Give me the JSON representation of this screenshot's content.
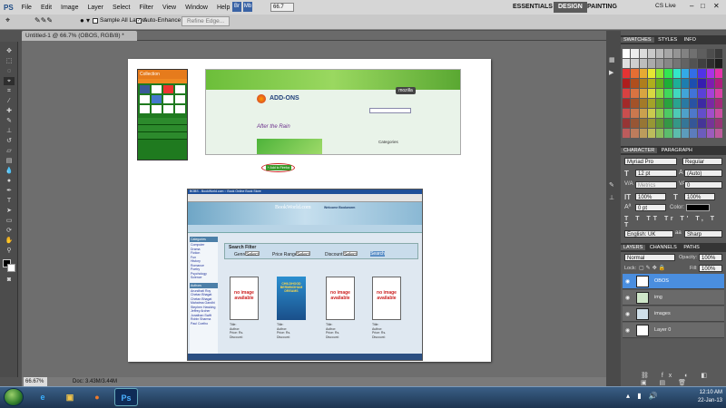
{
  "menubar": {
    "logo": "PS",
    "items": [
      "File",
      "Edit",
      "Image",
      "Layer",
      "Select",
      "Filter",
      "View",
      "Window",
      "Help"
    ],
    "zoom_box": "66.7",
    "workspaces": [
      "ESSENTIALS",
      "DESIGN",
      "PAINTING"
    ],
    "cs_live": "CS Live"
  },
  "options_bar": {
    "sample_all_layers": "Sample All Layers",
    "auto_enhance": "Auto-Enhance",
    "refine_edge": "Refine Edge..."
  },
  "document_tab": "Untitled-1 @ 66.7% (OBOS, RGB/8) *",
  "status": {
    "zoom": "66.67%",
    "doc": "Doc: 3.43M/3.44M"
  },
  "panels": {
    "swatches_tabs": [
      "SWATCHES",
      "STYLES",
      "INFO"
    ],
    "character_tabs": [
      "CHARACTER",
      "PARAGRAPH"
    ],
    "font_family": "Myriad Pro",
    "font_style": "Regular",
    "font_size": "12 pt",
    "leading": "(Auto)",
    "kerning": "Metrics",
    "tracking": "0",
    "vscale": "100%",
    "hscale": "100%",
    "baseline": "0 pt",
    "color_label": "Color:",
    "language": "English: UK",
    "antialias": "Sharp",
    "layers_tabs": [
      "LAYERS",
      "CHANNELS",
      "PATHS"
    ],
    "blend_mode": "Normal",
    "opacity_label": "Opacity:",
    "opacity": "100%",
    "lock_label": "Lock:",
    "fill_label": "Fill:",
    "fill": "100%",
    "layers": [
      "OBOS",
      "img",
      "images",
      "Layer 0"
    ]
  },
  "canvas_content": {
    "mobile_header": "Collection",
    "addons_title": "ADD-ONS",
    "addon_name": "After the Rain",
    "mozilla_badge": "mozilla",
    "categories_label": "Categories",
    "add_button": "+ Add to Firefox",
    "browser_title": "BOBS - BookWorld.com :: Book Online Book Store",
    "site_name": "BookWorld.com",
    "welcome_text": "Welcome Bookworm",
    "search_title": "Search Filter",
    "filters": [
      "Genre:",
      "Price Range:",
      "Discount:"
    ],
    "select_label": "Select",
    "search_button": "Search",
    "sidebar_heads": [
      "Categories",
      "Authors"
    ],
    "categories": [
      "Computer",
      "Drama",
      "Fiction",
      "Fun",
      "History",
      "Romance",
      "Poetry",
      "Psychology",
      "Science"
    ],
    "authors": [
      "Arundhati Roy",
      "Chetan Bhagat",
      "Chetan Bhagat",
      "Mahatma Gandhi",
      "Stephen Hawking",
      "Jeffrey Archer",
      "Jonathan Swift",
      "Robin Sharma",
      "Paul Coelho"
    ],
    "book_card_fields": [
      "Title:",
      "Author:",
      "Price: Rs.",
      "Discount:"
    ],
    "no_image": "no image available",
    "book_cover_title": "CHILDHOOD BERMINGHAM DREAMS"
  },
  "taskbar": {
    "time": "12:10 AM",
    "date": "22-Jan-13",
    "ps_label": "Ps"
  }
}
